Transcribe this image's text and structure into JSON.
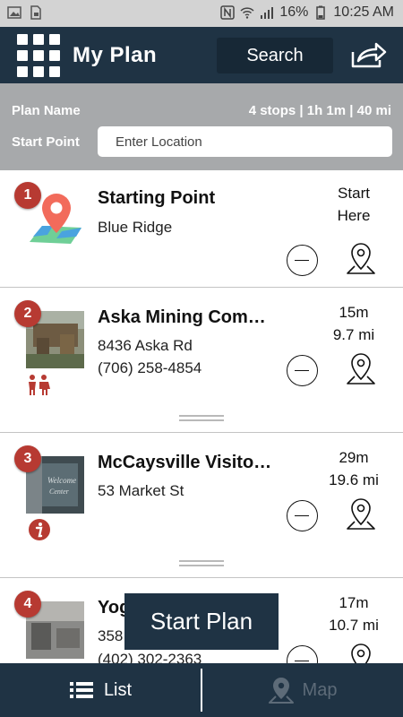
{
  "status_bar": {
    "battery": "16%",
    "time": "10:25 AM"
  },
  "header": {
    "title": "My Plan",
    "search_label": "Search"
  },
  "plan": {
    "name_label": "Plan Name",
    "stats": "4 stops | 1h 1m | 40 mi",
    "start_label": "Start Point",
    "start_placeholder": "Enter Location"
  },
  "stops": [
    {
      "number": "1",
      "name": "Starting Point",
      "lines": [
        "Blue Ridge"
      ],
      "time": "Start",
      "distance": "Here"
    },
    {
      "number": "2",
      "name": "Aska Mining Com…",
      "lines": [
        "8436 Aska Rd",
        "(706) 258-4854"
      ],
      "time": "15m",
      "distance": "9.7 mi"
    },
    {
      "number": "3",
      "name": "McCaysville Visito…",
      "lines": [
        "53 Market St"
      ],
      "time": "29m",
      "distance": "19.6 mi"
    },
    {
      "number": "4",
      "name": "Yog",
      "lines": [
        "358",
        "(402) 302-2363"
      ],
      "time": "17m",
      "distance": "10.7 mi"
    }
  ],
  "start_plan_label": "Start Plan",
  "bottom_nav": {
    "list_label": "List",
    "map_label": "Map"
  },
  "icons": {
    "menu": "grid-menu-icon",
    "share": "share-icon",
    "stop_1_thumb": "map-pin-icon",
    "family": "family-icon",
    "info": "info-icon",
    "remove": "minus-circle-icon",
    "locate": "location-pin-icon"
  },
  "colors": {
    "primary": "#1f3344",
    "badge": "#b73a32",
    "plan_bar": "#a7a9ab",
    "map_pin": "#f26b5b",
    "map_green": "#6fcf97"
  }
}
